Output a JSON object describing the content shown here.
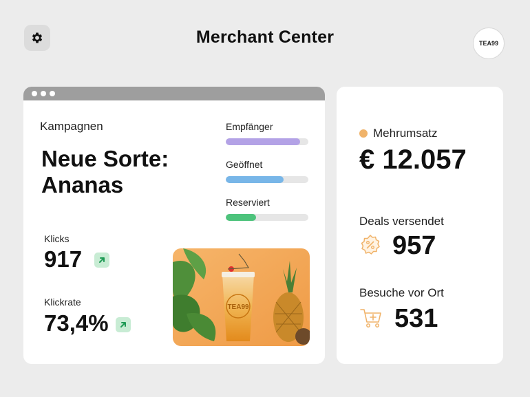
{
  "header": {
    "title": "Merchant Center",
    "settings_icon": "gear-icon",
    "avatar_logo": "TEA99"
  },
  "campaign": {
    "section_label": "Kampagnen",
    "title_line1": "Neue Sorte:",
    "title_line2": "Ananas",
    "bars": [
      {
        "label": "Empfänger",
        "value": 0.9,
        "color": "#b3a2e6"
      },
      {
        "label": "Geöffnet",
        "value": 0.7,
        "color": "#78b6e8"
      },
      {
        "label": "Reserviert",
        "value": 0.37,
        "color": "#4dc37c"
      }
    ],
    "clicks": {
      "label": "Klicks",
      "value": "917"
    },
    "click_rate": {
      "label": "Klickrate",
      "value": "73,4%"
    },
    "trend_icon": "arrow-up-right-icon"
  },
  "stats": {
    "mehrumsatz": {
      "label": "Mehrumsatz",
      "value": "€ 12.057",
      "dot_color": "#f0b36a"
    },
    "deals": {
      "label": "Deals versendet",
      "value": "957",
      "icon": "percent-badge-icon"
    },
    "visits": {
      "label": "Besuche vor Ort",
      "value": "531",
      "icon": "shopping-cart-icon"
    }
  },
  "colors": {
    "background": "#ececec",
    "accent_orange": "#f0b36a",
    "trend_green_bg": "#c8ecd4",
    "trend_green": "#1f9a55"
  }
}
